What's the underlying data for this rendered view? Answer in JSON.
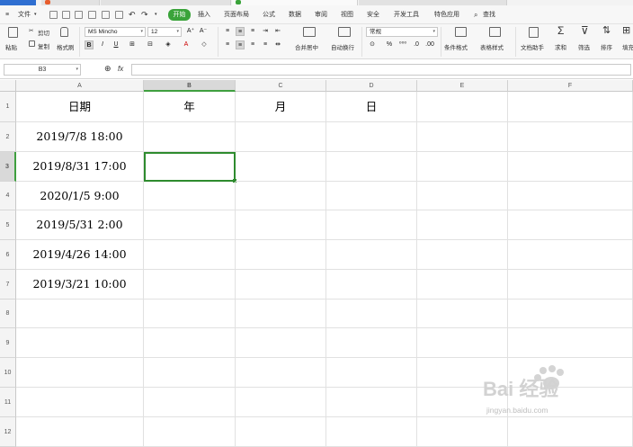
{
  "menu": {
    "file": "文件",
    "tabs": [
      "开始",
      "插入",
      "页面布局",
      "公式",
      "数据",
      "审阅",
      "视图",
      "安全",
      "开发工具",
      "特色应用"
    ],
    "search": "查找"
  },
  "ribbon": {
    "paste": "粘贴",
    "cut": "剪切",
    "copy": "复制",
    "format_painter": "格式刷",
    "font_name": "MS Mincho",
    "font_size": "12",
    "merge_center": "合并居中",
    "wrap_text": "自动换行",
    "number_format": "常规",
    "conditional_format": "条件格式",
    "table_style": "表格样式",
    "doc_assistant": "文档助手",
    "sum": "求和",
    "filter": "筛选",
    "sort": "排序",
    "fill": "填充"
  },
  "formula_bar": {
    "name_box": "B3",
    "fx": "fx",
    "formula": ""
  },
  "sheet": {
    "columns": [
      "A",
      "B",
      "C",
      "D",
      "E",
      "F"
    ],
    "rows": [
      "1",
      "2",
      "3",
      "4",
      "5",
      "6",
      "7",
      "8",
      "9",
      "10",
      "11",
      "12"
    ],
    "selected_cell": "B3",
    "header_row": [
      "日期",
      "年",
      "月",
      "日"
    ],
    "dates": [
      "2019/7/8  18:00",
      "2019/8/31  17:00",
      "2020/1/5  9:00",
      "2019/5/31  2:00",
      "2019/4/26  14:00",
      "2019/3/21  10:00"
    ]
  },
  "colors": {
    "accent_green": "#3aa33a",
    "selection_green": "#2e8b2e",
    "title_blue": "#2f6fd1"
  },
  "watermark": {
    "brand": "Bai 经验",
    "url": "jingyan.baidu.com"
  }
}
